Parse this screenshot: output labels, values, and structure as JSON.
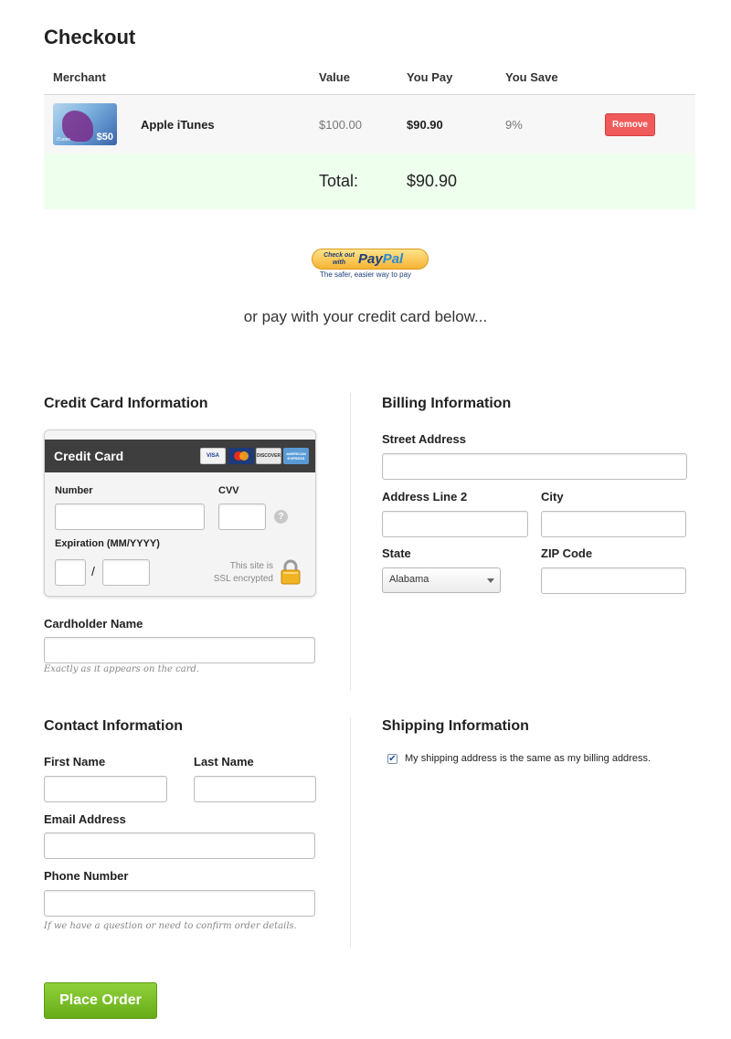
{
  "page": {
    "title": "Checkout"
  },
  "cart": {
    "headers": {
      "merchant": "Merchant",
      "value": "Value",
      "you_pay": "You Pay",
      "you_save": "You Save"
    },
    "items": [
      {
        "merchant": "Apple iTunes",
        "value": "$100.00",
        "you_pay": "$90.90",
        "you_save": "9%",
        "remove_label": "Remove",
        "card_amount": "$50",
        "card_brand": "iTunes"
      }
    ],
    "total_label": "Total:",
    "total_value": "$90.90"
  },
  "paypal": {
    "checkout_text": "Check out with",
    "brand": "PayPal",
    "tagline": "The safer, easier way to pay"
  },
  "or_pay_text": "or pay with your credit card below...",
  "credit_card": {
    "heading": "Credit Card Information",
    "box_title": "Credit Card",
    "card_logos": [
      "VISA",
      "MasterCard",
      "DISCOVER",
      "AMERICAN EXPRESS"
    ],
    "number_label": "Number",
    "cvv_label": "CVV",
    "help_glyph": "?",
    "expiration_label": "Expiration (MM/YYYY)",
    "expiration_separator": "/",
    "ssl_text_1": "This site is",
    "ssl_text_2": "SSL encrypted",
    "cardholder_label": "Cardholder Name",
    "cardholder_hint": "Exactly as it appears on the card."
  },
  "billing": {
    "heading": "Billing Information",
    "street_label": "Street Address",
    "address2_label": "Address Line 2",
    "city_label": "City",
    "state_label": "State",
    "state_value": "Alabama",
    "zip_label": "ZIP Code"
  },
  "contact": {
    "heading": "Contact Information",
    "first_name_label": "First Name",
    "last_name_label": "Last Name",
    "email_label": "Email Address",
    "phone_label": "Phone Number",
    "phone_hint": "If we have a question or need to confirm order details."
  },
  "shipping": {
    "heading": "Shipping Information",
    "same_as_billing_label": "My shipping address is the same as my billing address.",
    "same_as_billing_checked": true
  },
  "place_order_label": "Place Order",
  "colors": {
    "remove": "#f05a5a",
    "total_bg": "#eeffee",
    "place_order": "#76bd22",
    "cc_header": "#3e3e3e"
  }
}
